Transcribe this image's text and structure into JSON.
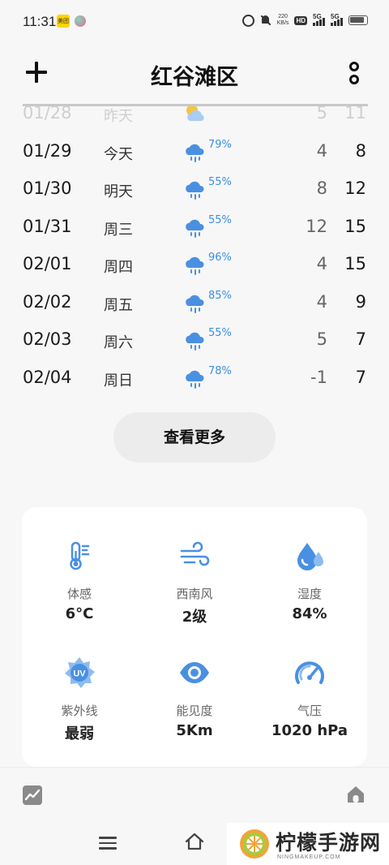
{
  "status_bar": {
    "time": "11:31",
    "app_badge": "美团",
    "net_speed_value": "220",
    "net_speed_unit": "KB/s",
    "hd_label": "HD",
    "sim1_label": "5G",
    "sim2_label": "5G"
  },
  "header": {
    "title": "红谷滩区",
    "add_icon": "plus-icon",
    "more_icon": "more-vertical-icon"
  },
  "forecast": [
    {
      "date": "01/28",
      "day": "昨天",
      "icon": "partly-cloudy-sun-icon",
      "rain": "",
      "low": "5",
      "high": "11",
      "faded": true
    },
    {
      "date": "01/29",
      "day": "今天",
      "icon": "rain-cloud-icon",
      "rain": "79%",
      "low": "4",
      "high": "8",
      "faded": false
    },
    {
      "date": "01/30",
      "day": "明天",
      "icon": "rain-cloud-icon",
      "rain": "55%",
      "low": "8",
      "high": "12",
      "faded": false
    },
    {
      "date": "01/31",
      "day": "周三",
      "icon": "rain-cloud-icon",
      "rain": "55%",
      "low": "12",
      "high": "15",
      "faded": false
    },
    {
      "date": "02/01",
      "day": "周四",
      "icon": "rain-cloud-icon",
      "rain": "96%",
      "low": "4",
      "high": "15",
      "faded": false
    },
    {
      "date": "02/02",
      "day": "周五",
      "icon": "rain-cloud-icon",
      "rain": "85%",
      "low": "4",
      "high": "9",
      "faded": false
    },
    {
      "date": "02/03",
      "day": "周六",
      "icon": "rain-cloud-icon",
      "rain": "55%",
      "low": "5",
      "high": "7",
      "faded": false
    },
    {
      "date": "02/04",
      "day": "周日",
      "icon": "rain-cloud-icon",
      "rain": "78%",
      "low": "-1",
      "high": "7",
      "faded": false
    }
  ],
  "see_more_label": "查看更多",
  "details": {
    "feels_like": {
      "label": "体感",
      "value": "6°C",
      "icon": "thermometer-icon"
    },
    "wind": {
      "label": "西南风",
      "value": "2级",
      "icon": "wind-icon"
    },
    "humidity": {
      "label": "湿度",
      "value": "84%",
      "icon": "humidity-drop-icon"
    },
    "uv": {
      "label": "紫外线",
      "value": "最弱",
      "icon": "uv-sun-icon",
      "icon_text": "UV"
    },
    "visibility": {
      "label": "能见度",
      "value": "5Km",
      "icon": "eye-icon"
    },
    "pressure": {
      "label": "气压",
      "value": "1020 hPa",
      "icon": "gauge-icon"
    }
  },
  "bottom_bar": {
    "trend_icon": "trend-chart-icon",
    "home_icon": "home-icon"
  },
  "nav_bar": {
    "menu_icon": "menu-icon",
    "home_icon": "home-outline-icon"
  },
  "watermark": {
    "text": "柠檬手游网",
    "sub": "NINGMAKEUP.COM"
  },
  "colors": {
    "accent_blue": "#3d8fe0",
    "icon_blue": "#4a90e2",
    "background": "#f7f7f7",
    "card": "#ffffff"
  }
}
